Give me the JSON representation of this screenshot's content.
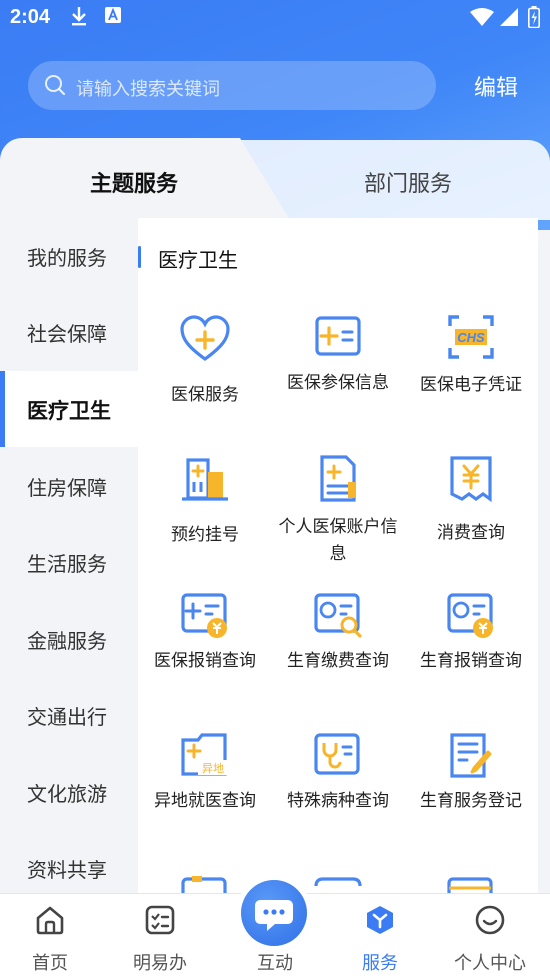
{
  "status_bar": {
    "time": "2:04"
  },
  "search": {
    "placeholder": "请输入搜索关键词"
  },
  "header": {
    "edit_label": "编辑"
  },
  "tabs": [
    {
      "label": "主题服务"
    },
    {
      "label": "部门服务"
    }
  ],
  "sidebar": {
    "items": [
      {
        "label": "我的服务"
      },
      {
        "label": "社会保障"
      },
      {
        "label": "医疗卫生"
      },
      {
        "label": "住房保障"
      },
      {
        "label": "生活服务"
      },
      {
        "label": "金融服务"
      },
      {
        "label": "交通出行"
      },
      {
        "label": "文化旅游"
      },
      {
        "label": "资料共享"
      }
    ],
    "active_index": 2
  },
  "main": {
    "section_title": "医疗卫生",
    "items": [
      {
        "label": "医保服务",
        "icon": "heart-plus-icon"
      },
      {
        "label": "医保参保信息",
        "icon": "card-plus-icon"
      },
      {
        "label": "医保电子凭证",
        "icon": "chs-icon"
      },
      {
        "label": "预约挂号",
        "icon": "hospital-building-icon"
      },
      {
        "label": "个人医保账户信息",
        "icon": "document-plus-icon"
      },
      {
        "label": "消费查询",
        "icon": "yuan-receipt-icon"
      },
      {
        "label": "医保报销查询",
        "icon": "card-yuan-icon"
      },
      {
        "label": "生育缴费查询",
        "icon": "baby-card-search-icon"
      },
      {
        "label": "生育报销查询",
        "icon": "baby-card-yuan-icon"
      },
      {
        "label": "异地就医查询",
        "icon": "folder-remote-icon",
        "badge": "异地"
      },
      {
        "label": "特殊病种查询",
        "icon": "stethoscope-card-icon"
      },
      {
        "label": "生育服务登记",
        "icon": "document-pen-icon"
      }
    ]
  },
  "bottom_nav": {
    "items": [
      {
        "label": "首页",
        "icon": "home-icon"
      },
      {
        "label": "明易办",
        "icon": "checklist-icon"
      },
      {
        "label": "互动",
        "icon": "chat-bubble-icon"
      },
      {
        "label": "服务",
        "icon": "service-cube-icon"
      },
      {
        "label": "个人中心",
        "icon": "smile-icon"
      }
    ],
    "active_index": 3
  },
  "colors": {
    "accent": "#3b7cf4",
    "icon_blue": "#4a86f0",
    "icon_yellow": "#f7b52c"
  }
}
